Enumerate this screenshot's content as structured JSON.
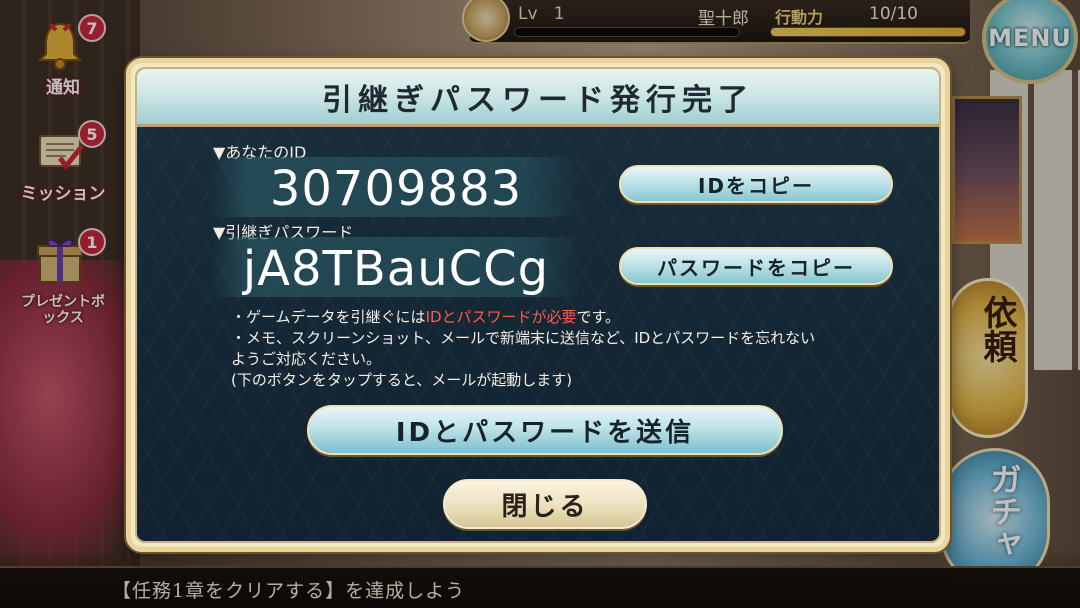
{
  "hud": {
    "level_label": "Lv",
    "level_value": "1",
    "player_name": "聖十郎",
    "stamina_label": "行動力",
    "stamina_value": "10/10",
    "stamina_fraction": 1.0,
    "menu_label": "MENU"
  },
  "side": {
    "notice": {
      "label": "通知",
      "badge": "7",
      "icon": "bell-icon"
    },
    "mission": {
      "label": "ミッション",
      "badge": "5",
      "icon": "scroll-icon"
    },
    "present": {
      "label": "プレゼントボックス",
      "badge": "1",
      "icon": "giftbox-icon"
    }
  },
  "right": {
    "request_label": "依頼",
    "gacha_label": "ガチャ"
  },
  "mission_bar": {
    "text": "【任務1章をクリアする】を達成しよう"
  },
  "dialog": {
    "title": "引継ぎパスワード発行完了",
    "id_label": "▼あなたのID",
    "id_value": "30709883",
    "password_label": "▼引継ぎパスワード",
    "password_value": "jA8TBauCCg",
    "copy_id_button": "IDをコピー",
    "copy_password_button": "パスワードをコピー",
    "note1_prefix": "・ゲームデータを引継ぐには",
    "note1_highlight": "IDとパスワードが必要",
    "note1_suffix": "です。",
    "note2": "・メモ、スクリーンショット、メールで新端末に送信など、IDとパスワードを忘れない",
    "note3": "ようご対応ください。",
    "note4": "(下のボタンをタップすると、メールが起動します)",
    "send_button": "IDとパスワードを送信",
    "close_button": "閉じる",
    "highlight_color": "#ff5a4a"
  }
}
